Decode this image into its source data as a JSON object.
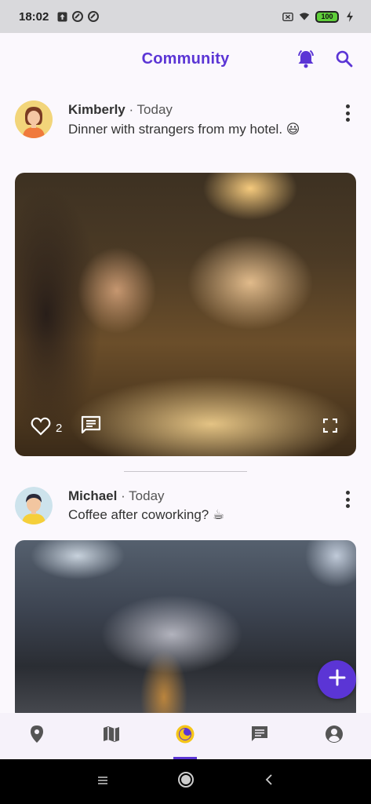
{
  "status_bar": {
    "time": "18:02",
    "battery": "100",
    "icons": [
      "upload-icon",
      "sync-icon",
      "sync-icon",
      "no-sim-icon",
      "wifi-icon",
      "battery-icon",
      "charging-icon"
    ]
  },
  "app_bar": {
    "title": "Community",
    "actions": [
      "notifications-icon",
      "search-icon"
    ]
  },
  "posts": [
    {
      "author": "Kimberly",
      "time": " · Today",
      "text": "Dinner with strangers from my hotel. 😃",
      "likes": "2"
    },
    {
      "author": "Michael",
      "time": " · Today",
      "text": "Coffee after coworking? ☕"
    }
  ],
  "bottom_nav": {
    "items": [
      "location-icon",
      "map-icon",
      "community-icon",
      "chat-icon",
      "account-icon"
    ],
    "active": "community-icon"
  },
  "colors": {
    "accent": "#5b35d5",
    "background": "#fbf8fd",
    "nav_background": "#f6f2fa"
  }
}
